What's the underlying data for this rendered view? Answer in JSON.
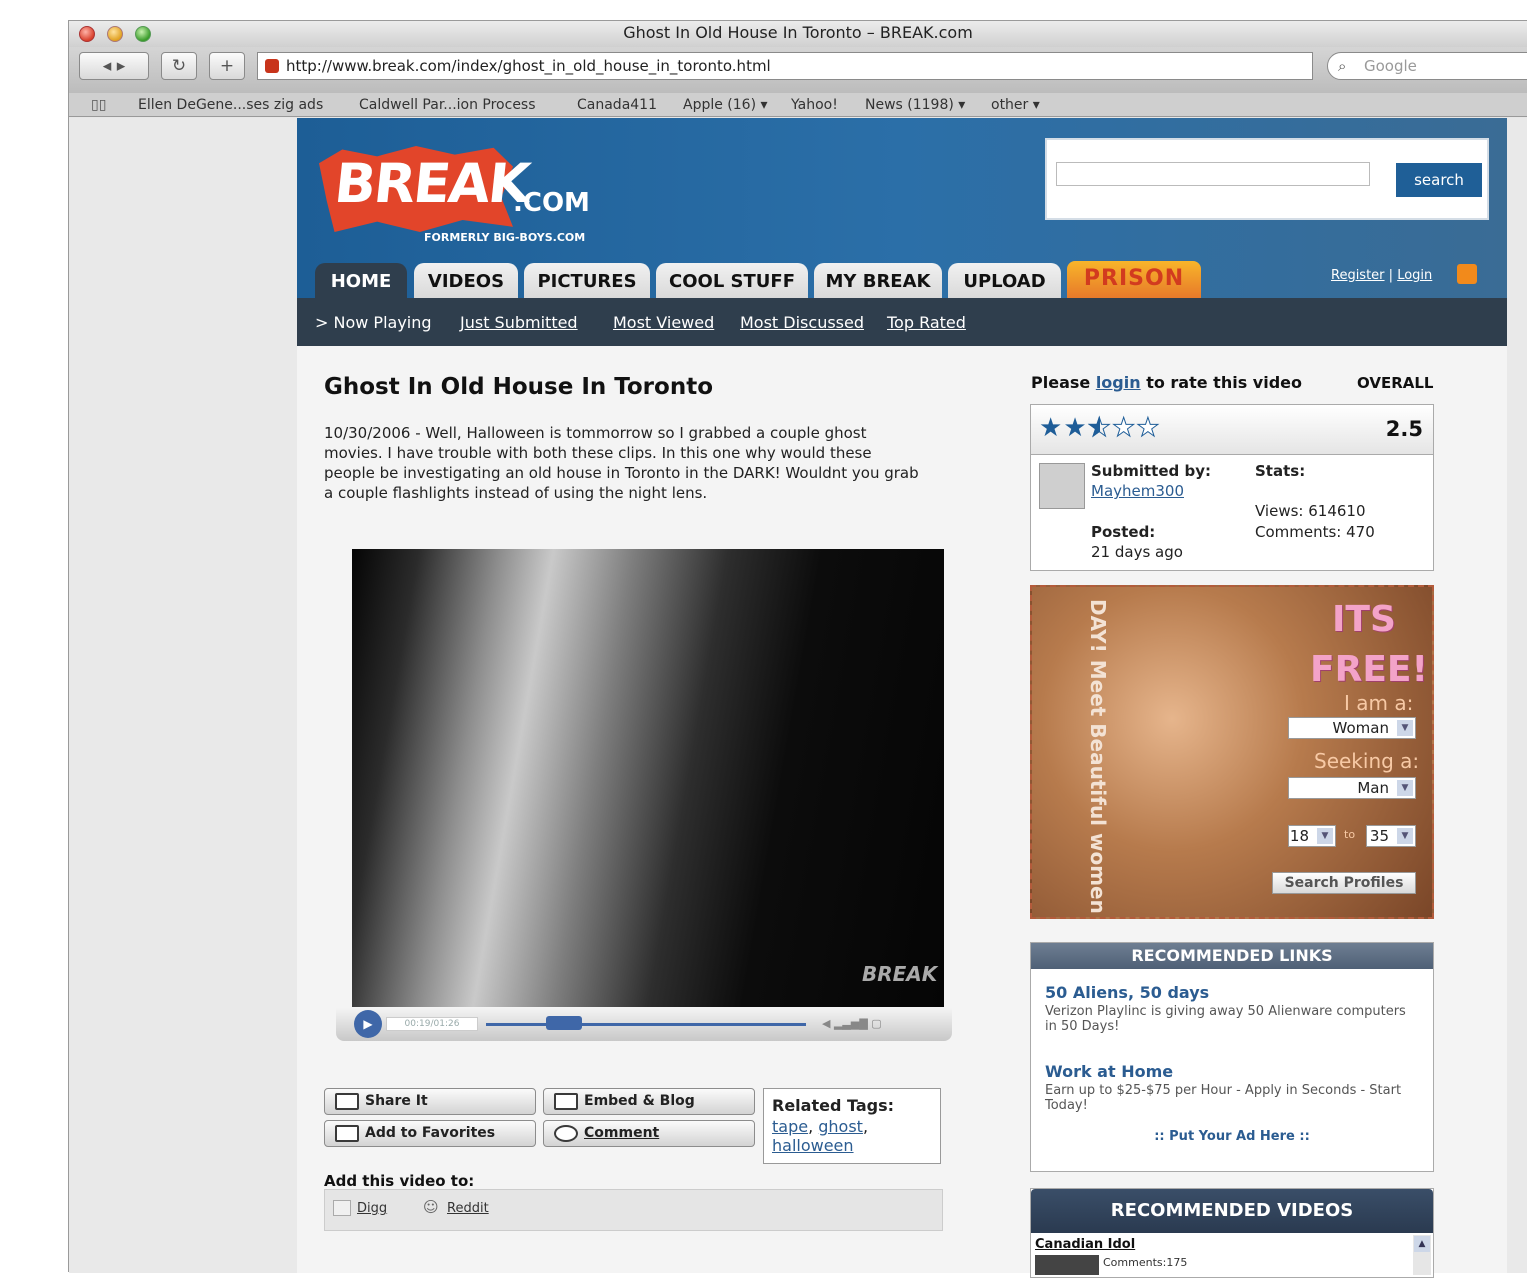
{
  "browser": {
    "title": "Ghost In Old House In Toronto – BREAK.com",
    "url": "http://www.break.com/index/ghost_in_old_house_in_toronto.html",
    "search_placeholder": "Google",
    "bookmarks": [
      "Ellen DeGene...ses zig ads",
      "Caldwell Par...ion Process",
      "Canada411",
      "Apple (16) ▾",
      "Yahoo!",
      "News (1198) ▾",
      "other ▾"
    ]
  },
  "site": {
    "logo_main": "BREAK",
    "logo_com": ".COM",
    "logo_sub": "FORMERLY BIG-BOYS.COM",
    "search_button": "search",
    "tabs": [
      "HOME",
      "VIDEOS",
      "PICTURES",
      "COOL STUFF",
      "MY BREAK",
      "UPLOAD"
    ],
    "promo_tab": "PRISON",
    "register": "Register",
    "login": "Login",
    "subnav": {
      "now_playing": "> Now Playing",
      "links": [
        "Just Submitted",
        "Most Viewed",
        "Most Discussed",
        "Top Rated"
      ]
    }
  },
  "video": {
    "title": "Ghost In Old House In Toronto",
    "description": "10/30/2006 - Well, Halloween is tommorrow so I grabbed a couple ghost movies. I have trouble with both these clips. In this one why would these people be investigating an old house in Toronto in the DARK! Wouldnt you grab a couple flashlights instead of using the night lens.",
    "time": "00:19/01:26",
    "progress": 0.3,
    "watermark": "BREAK"
  },
  "actions": {
    "share": "Share It",
    "embed": "Embed & Blog",
    "favorites": "Add to Favorites",
    "comment": "Comment",
    "related_label": "Related Tags:",
    "tags": [
      "tape",
      "ghost",
      "halloween"
    ],
    "add_to_label": "Add this video to:",
    "services": [
      "Digg",
      "Reddit"
    ]
  },
  "rating": {
    "prompt_pre": "Please",
    "prompt_link": "login",
    "prompt_post": "to rate this video",
    "overall_label": "OVERALL",
    "value": "2.5",
    "stars_filled": 2.5
  },
  "info": {
    "submitted_label": "Submitted by:",
    "submitter": "Mayhem300",
    "posted_label": "Posted:",
    "posted": "21 days ago",
    "stats_label": "Stats:",
    "views": "Views: 614610",
    "comments": "Comments: 470"
  },
  "ad": {
    "side_text": "DAY! Meet Beautiful women t",
    "its": "ITS",
    "free": "FREE!!",
    "iam_label": "I am a:",
    "iam_value": "Woman",
    "seeking_label": "Seeking a:",
    "seeking_value": "Man",
    "age_from": "18",
    "age_to_label": "to",
    "age_to": "35",
    "search_button": "Search Profiles"
  },
  "recommended_links": {
    "heading": "RECOMMENDED LINKS",
    "items": [
      {
        "title": "50 Aliens, 50 days",
        "desc": "Verizon Playlinc is giving away 50 Alienware computers in 50 Days!"
      },
      {
        "title": "Work at Home",
        "desc": "Earn up to $25-$75 per Hour - Apply in Seconds - Start Today!"
      }
    ],
    "put_ad": ":: Put Your Ad Here ::"
  },
  "recommended_videos": {
    "heading": "RECOMMENDED VIDEOS",
    "first_title": "Canadian Idol",
    "first_comments": "Comments:175"
  }
}
